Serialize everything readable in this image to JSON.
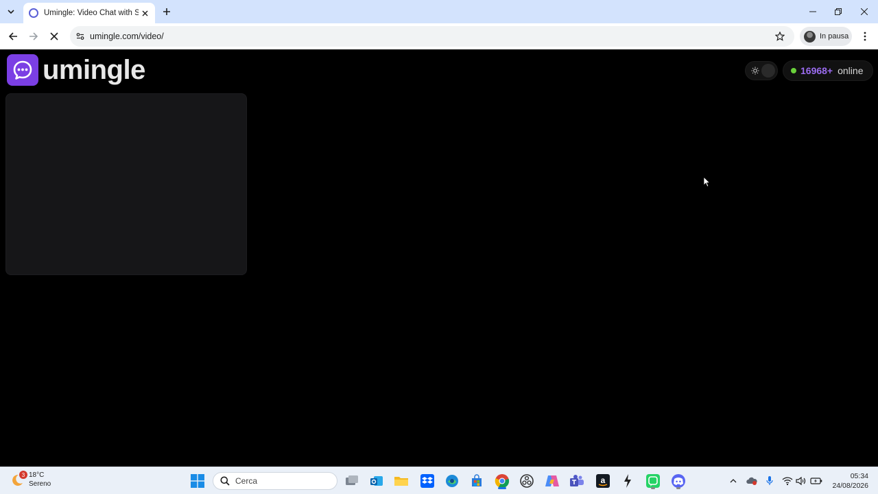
{
  "browser": {
    "tab_title": "Umingle: Video Chat with Stran",
    "url": "umingle.com/video/",
    "profile_label": "In pausa"
  },
  "page": {
    "logo_text": "umingle",
    "online_count": "16968+",
    "online_label": "online",
    "colors": {
      "brand": "#7b3fe4",
      "count": "#9b6cf0",
      "online_dot": "#6ad13b"
    }
  },
  "taskbar": {
    "weather_temp": "18°C",
    "weather_condition": "Sereno",
    "weather_badge": "3",
    "search_placeholder": "Cerca",
    "time": "05:34",
    "date": "24/08/2026",
    "apps": [
      "windows-start-icon",
      "task-view-icon",
      "outlook-icon",
      "file-explorer-icon",
      "dropbox-icon",
      "edge-icon",
      "store-icon",
      "chrome-icon",
      "obs-icon",
      "copilot-icon",
      "teams-icon",
      "amazon-icon",
      "lightning-app-icon",
      "whatsapp-icon",
      "discord-icon"
    ]
  }
}
